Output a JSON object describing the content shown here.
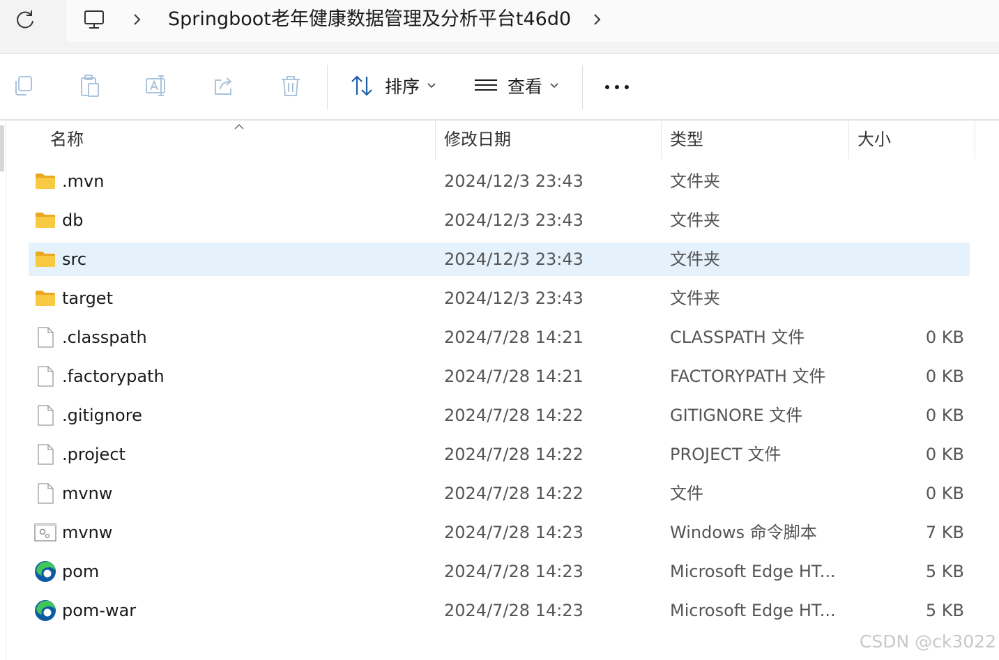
{
  "address_bar": {
    "path": "Springboot老年健康数据管理及分析平台t46d0"
  },
  "toolbar": {
    "sort_label": "排序",
    "view_label": "查看"
  },
  "columns": {
    "name": "名称",
    "date": "修改日期",
    "type": "类型",
    "size": "大小"
  },
  "files": [
    {
      "name": ".mvn",
      "date": "2024/12/3 23:43",
      "type": "文件夹",
      "size": "",
      "icon": "folder-icon",
      "selected": false
    },
    {
      "name": "db",
      "date": "2024/12/3 23:43",
      "type": "文件夹",
      "size": "",
      "icon": "folder-icon",
      "selected": false
    },
    {
      "name": "src",
      "date": "2024/12/3 23:43",
      "type": "文件夹",
      "size": "",
      "icon": "folder-icon",
      "selected": true
    },
    {
      "name": "target",
      "date": "2024/12/3 23:43",
      "type": "文件夹",
      "size": "",
      "icon": "folder-icon",
      "selected": false
    },
    {
      "name": ".classpath",
      "date": "2024/7/28 14:21",
      "type": "CLASSPATH 文件",
      "size": "0 KB",
      "icon": "file-icon",
      "selected": false
    },
    {
      "name": ".factorypath",
      "date": "2024/7/28 14:21",
      "type": "FACTORYPATH 文件",
      "size": "0 KB",
      "icon": "file-icon",
      "selected": false
    },
    {
      "name": ".gitignore",
      "date": "2024/7/28 14:22",
      "type": "GITIGNORE 文件",
      "size": "0 KB",
      "icon": "file-icon",
      "selected": false
    },
    {
      "name": ".project",
      "date": "2024/7/28 14:22",
      "type": "PROJECT 文件",
      "size": "0 KB",
      "icon": "file-icon",
      "selected": false
    },
    {
      "name": "mvnw",
      "date": "2024/7/28 14:22",
      "type": "文件",
      "size": "0 KB",
      "icon": "file-icon",
      "selected": false
    },
    {
      "name": "mvnw",
      "date": "2024/7/28 14:23",
      "type": "Windows 命令脚本",
      "size": "7 KB",
      "icon": "script-icon",
      "selected": false
    },
    {
      "name": "pom",
      "date": "2024/7/28 14:23",
      "type": "Microsoft Edge HT...",
      "size": "5 KB",
      "icon": "edge-icon",
      "selected": false
    },
    {
      "name": "pom-war",
      "date": "2024/7/28 14:23",
      "type": "Microsoft Edge HT...",
      "size": "5 KB",
      "icon": "edge-icon",
      "selected": false
    }
  ],
  "watermark": "CSDN @ck3022",
  "colors": {
    "selection": "#e5f1fb",
    "folder": "#f8c942",
    "edge_blue": "#0c59a4",
    "edge_green": "#3fc75a"
  }
}
